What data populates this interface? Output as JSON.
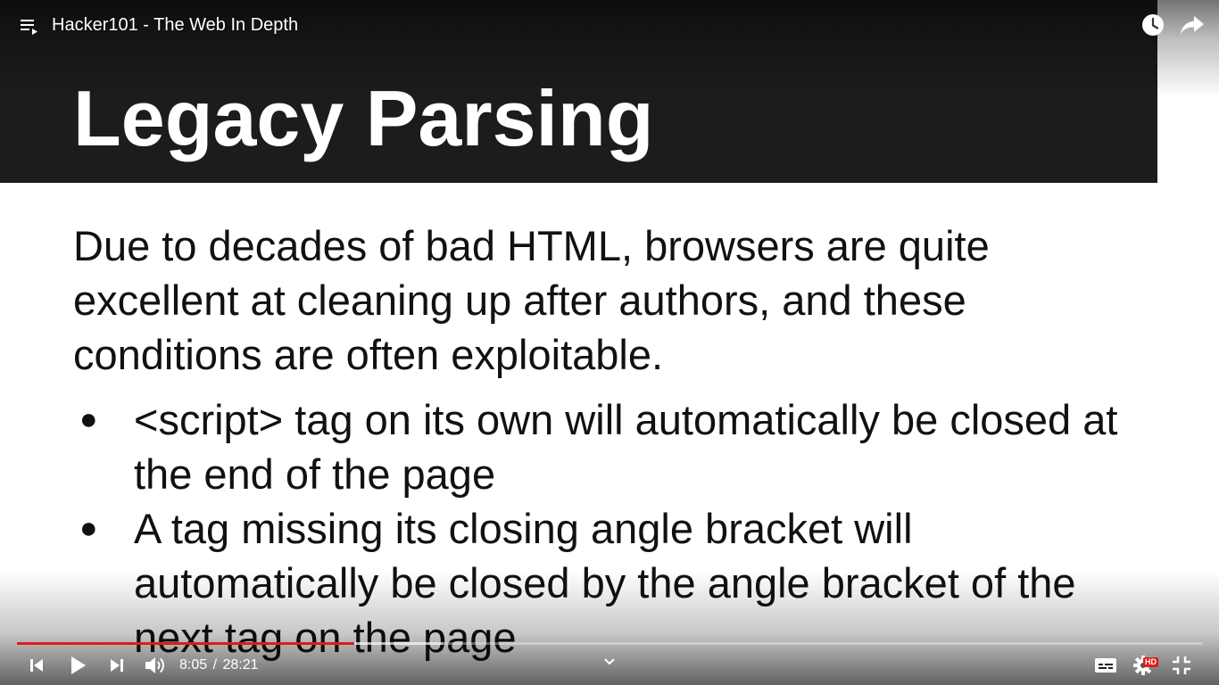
{
  "player": {
    "video_title": "Hacker101 - The Web In Depth",
    "current_time": "8:05",
    "time_separator": "/",
    "duration": "28:21",
    "hd_badge": "HD",
    "progress_fraction": 0.285,
    "buffered_fraction": 0.36,
    "accent_color": "#e21a1a",
    "icons": {
      "playlist": "playlist-icon",
      "watch_later": "clock-icon",
      "share": "share-arrow-icon",
      "previous": "skip-previous-icon",
      "play": "play-icon",
      "next": "skip-next-icon",
      "volume": "volume-icon",
      "chevron": "chevron-down-icon",
      "captions": "captions-icon",
      "settings": "gear-icon",
      "fullscreen": "exit-fullscreen-icon"
    }
  },
  "slide": {
    "title": "Legacy Parsing",
    "intro": "Due to decades of bad HTML, browsers are quite excellent at cleaning up after authors, and these conditions are often exploitable.",
    "bullet_glyph": "●",
    "bullets": [
      "<script> tag on its own will automatically be closed at the end of the page",
      "A tag missing its closing angle bracket will automatically be closed by the angle bracket of the next tag on the page"
    ],
    "title_band_color": "#1c1c1d"
  }
}
